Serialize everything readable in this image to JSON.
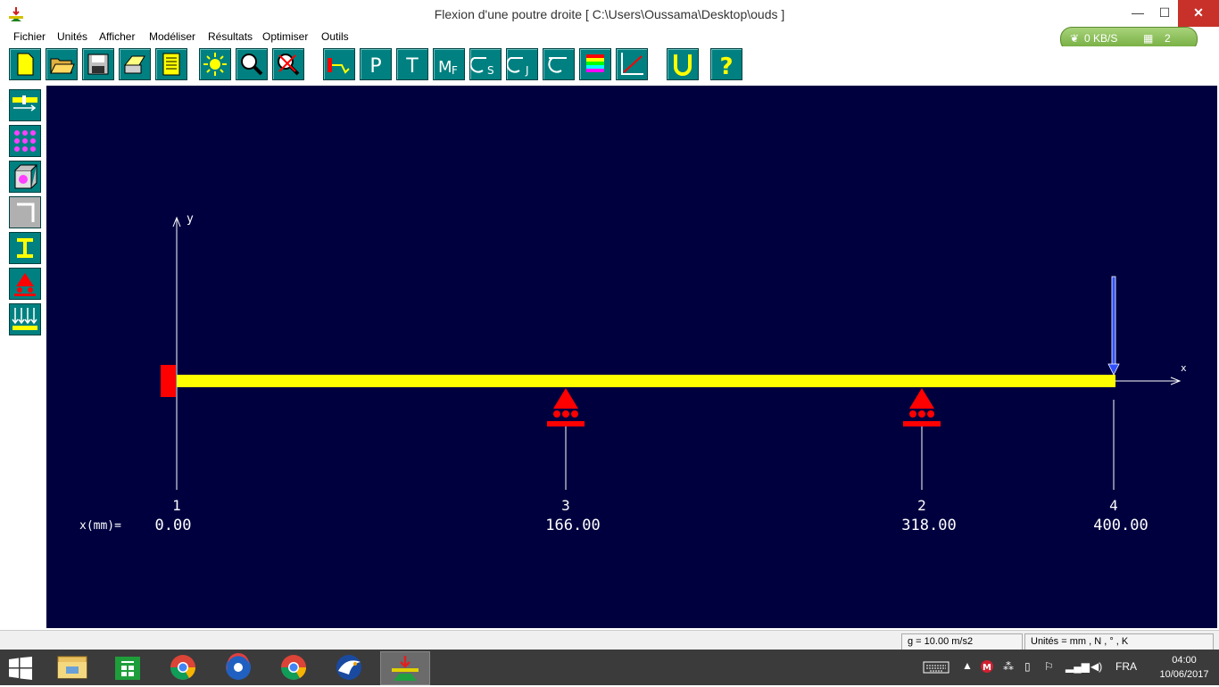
{
  "window": {
    "title": "Flexion d'une poutre droite     [ C:\\Users\\Oussama\\Desktop\\ouds ]",
    "minimize": "—",
    "maximize": "☐",
    "close": "✕"
  },
  "menu": [
    "Fichier",
    "Unités",
    "Afficher",
    "Modéliser",
    "Résultats",
    "Optimiser",
    "Outils"
  ],
  "net_widget": {
    "speed": "0 KB/S",
    "count": "2"
  },
  "toolbar": {
    "buttons": [
      "new-file",
      "open-folder",
      "save",
      "print",
      "report",
      "sun",
      "zoom",
      "zoom-reset",
      "beam-load",
      "P",
      "T",
      "MF",
      "σS",
      "σJ",
      "σ",
      "color-scale",
      "xy-plot",
      "U",
      "?"
    ],
    "labels": {
      "P": "P",
      "T": "T",
      "MF": "MF",
      "S": "S",
      "J": "J",
      "U": "U",
      "Q": "?"
    }
  },
  "left_toolbar": [
    "beam-geometry",
    "material",
    "section",
    "profile",
    "I-section",
    "supports",
    "distributed-load"
  ],
  "canvas": {
    "y_axis_label": "y",
    "x_axis_label": "x",
    "x_prefix": "x(mm)=",
    "nodes": [
      {
        "id": "1",
        "x": "0.00",
        "type": "clamp"
      },
      {
        "id": "3",
        "x": "166.00",
        "type": "roller"
      },
      {
        "id": "2",
        "x": "318.00",
        "type": "roller"
      },
      {
        "id": "4",
        "x": "400.00",
        "type": "load"
      }
    ],
    "colors": {
      "background": "#00003f",
      "beam": "#ffff00",
      "support": "#ff0000",
      "load": "#3050ff"
    }
  },
  "status": {
    "gravity": "g = 10.00 m/s2",
    "units": "Unités = mm , N , ° , K"
  },
  "taskbar": {
    "apps": [
      "file-explorer",
      "store",
      "chrome",
      "browser",
      "chrome-2",
      "eagle-app",
      "rdm-flexion"
    ],
    "lang": "FRA",
    "time": "04:00",
    "date": "10/06/2017"
  }
}
